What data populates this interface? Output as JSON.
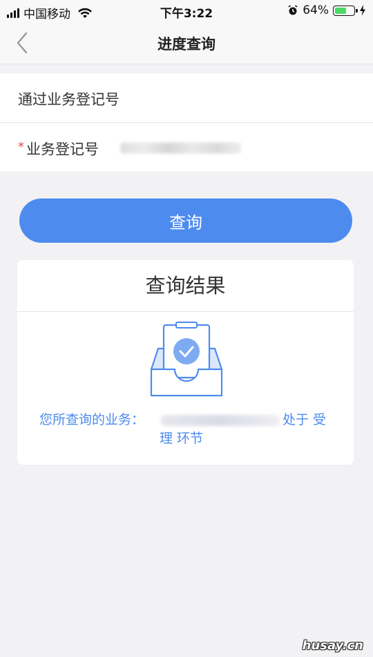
{
  "status_bar": {
    "carrier": "中国移动",
    "time": "下午3:22",
    "battery_percent": "64%",
    "battery_level": 0.64
  },
  "nav": {
    "title": "进度查询",
    "back_icon": "chevron-left-icon"
  },
  "form": {
    "section_label": "通过业务登记号",
    "field_label": "业务登记号",
    "required_mark": "*"
  },
  "query_button_label": "查询",
  "result": {
    "title": "查询结果",
    "message_prefix": "您所查询的业务：",
    "message_suffix": "处于 受",
    "message_line2": "理 环节",
    "icon": "inbox-check-icon",
    "accent_color": "#4d8bef"
  },
  "watermark": "husay.cn"
}
